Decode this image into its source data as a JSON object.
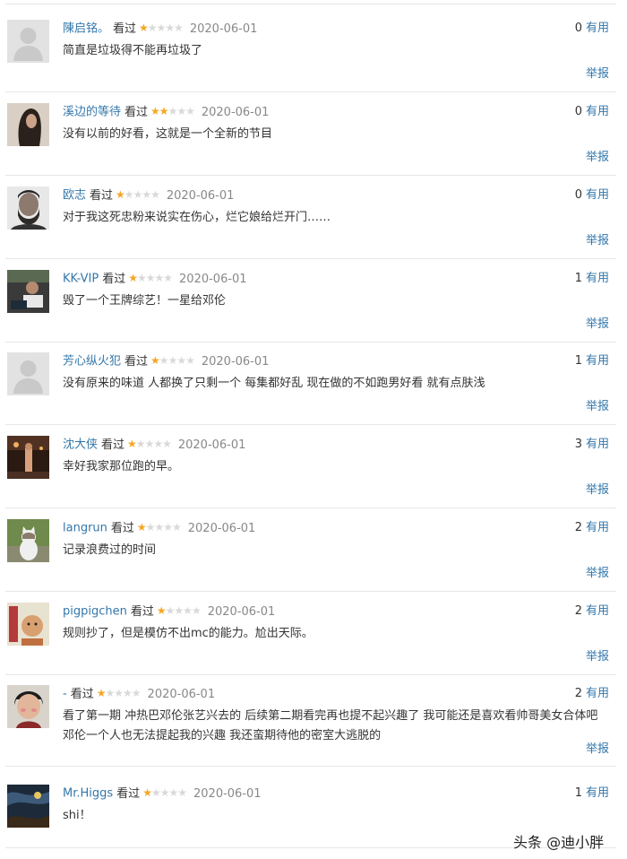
{
  "reviews": [
    {
      "user": "陳启铭。",
      "watched": "看过",
      "rating": 1,
      "date": "2020-06-01",
      "votes": "0",
      "useful": "有用",
      "text": "简直是垃圾得不能再垃圾了",
      "report": "举报",
      "avatar": "default-avatar"
    },
    {
      "user": "溪边的等待",
      "watched": "看过",
      "rating": 2,
      "date": "2020-06-01",
      "votes": "0",
      "useful": "有用",
      "text": "没有以前的好看，这就是一个全新的节目",
      "report": "举报",
      "avatar": "long-hair-photo"
    },
    {
      "user": "欧志",
      "watched": "看过",
      "rating": 1,
      "date": "2020-06-01",
      "votes": "0",
      "useful": "有用",
      "text": "对于我这死忠粉来说实在伤心，烂它娘给烂开门……",
      "report": "举报",
      "avatar": "bearded-man-photo"
    },
    {
      "user": "KK-VIP",
      "watched": "看过",
      "rating": 1,
      "date": "2020-06-01",
      "votes": "1",
      "useful": "有用",
      "text": "毁了一个王牌综艺！一星给邓伦",
      "report": "举报",
      "avatar": "person-laptop-photo"
    },
    {
      "user": "芳心纵火犯",
      "watched": "看过",
      "rating": 1,
      "date": "2020-06-01",
      "votes": "1",
      "useful": "有用",
      "text": "没有原来的味道 人都换了只剩一个 每集都好乱 现在做的不如跑男好看 就有点肤浅",
      "report": "举报",
      "avatar": "default-avatar"
    },
    {
      "user": "沈大侠",
      "watched": "看过",
      "rating": 1,
      "date": "2020-06-01",
      "votes": "3",
      "useful": "有用",
      "text": "幸好我家那位跑的早。",
      "report": "举报",
      "avatar": "night-street-photo"
    },
    {
      "user": "langrun",
      "watched": "看过",
      "rating": 1,
      "date": "2020-06-01",
      "votes": "2",
      "useful": "有用",
      "text": "记录浪费过的时间",
      "report": "举报",
      "avatar": "cat-photo"
    },
    {
      "user": "pigpigchen",
      "watched": "看过",
      "rating": 1,
      "date": "2020-06-01",
      "votes": "2",
      "useful": "有用",
      "text": "规则抄了，但是模仿不出mc的能力。尬出天际。",
      "report": "举报",
      "avatar": "cartoon-avatar"
    },
    {
      "user": "-",
      "watched": "看过",
      "rating": 1,
      "date": "2020-06-01",
      "votes": "2",
      "useful": "有用",
      "text": "看了第一期 冲热巴邓伦张艺兴去的 后续第二期看完再也提不起兴趣了 我可能还是喜欢看帅哥美女合体吧 邓伦一个人也无法提起我的兴趣 我还蛮期待他的密室大逃脱的",
      "report": "举报",
      "avatar": "comedian-photo"
    },
    {
      "user": "Mr.Higgs",
      "watched": "看过",
      "rating": 1,
      "date": "2020-06-01",
      "votes": "1",
      "useful": "有用",
      "text": "shi！",
      "report": "举报",
      "avatar": "dark-painting-photo"
    }
  ],
  "watermark": "头条 @迪小胖",
  "colors": {
    "link": "#3377aa",
    "star": "#f5a623",
    "star_off": "#d9d9d9",
    "divider": "#e6e6e6"
  }
}
